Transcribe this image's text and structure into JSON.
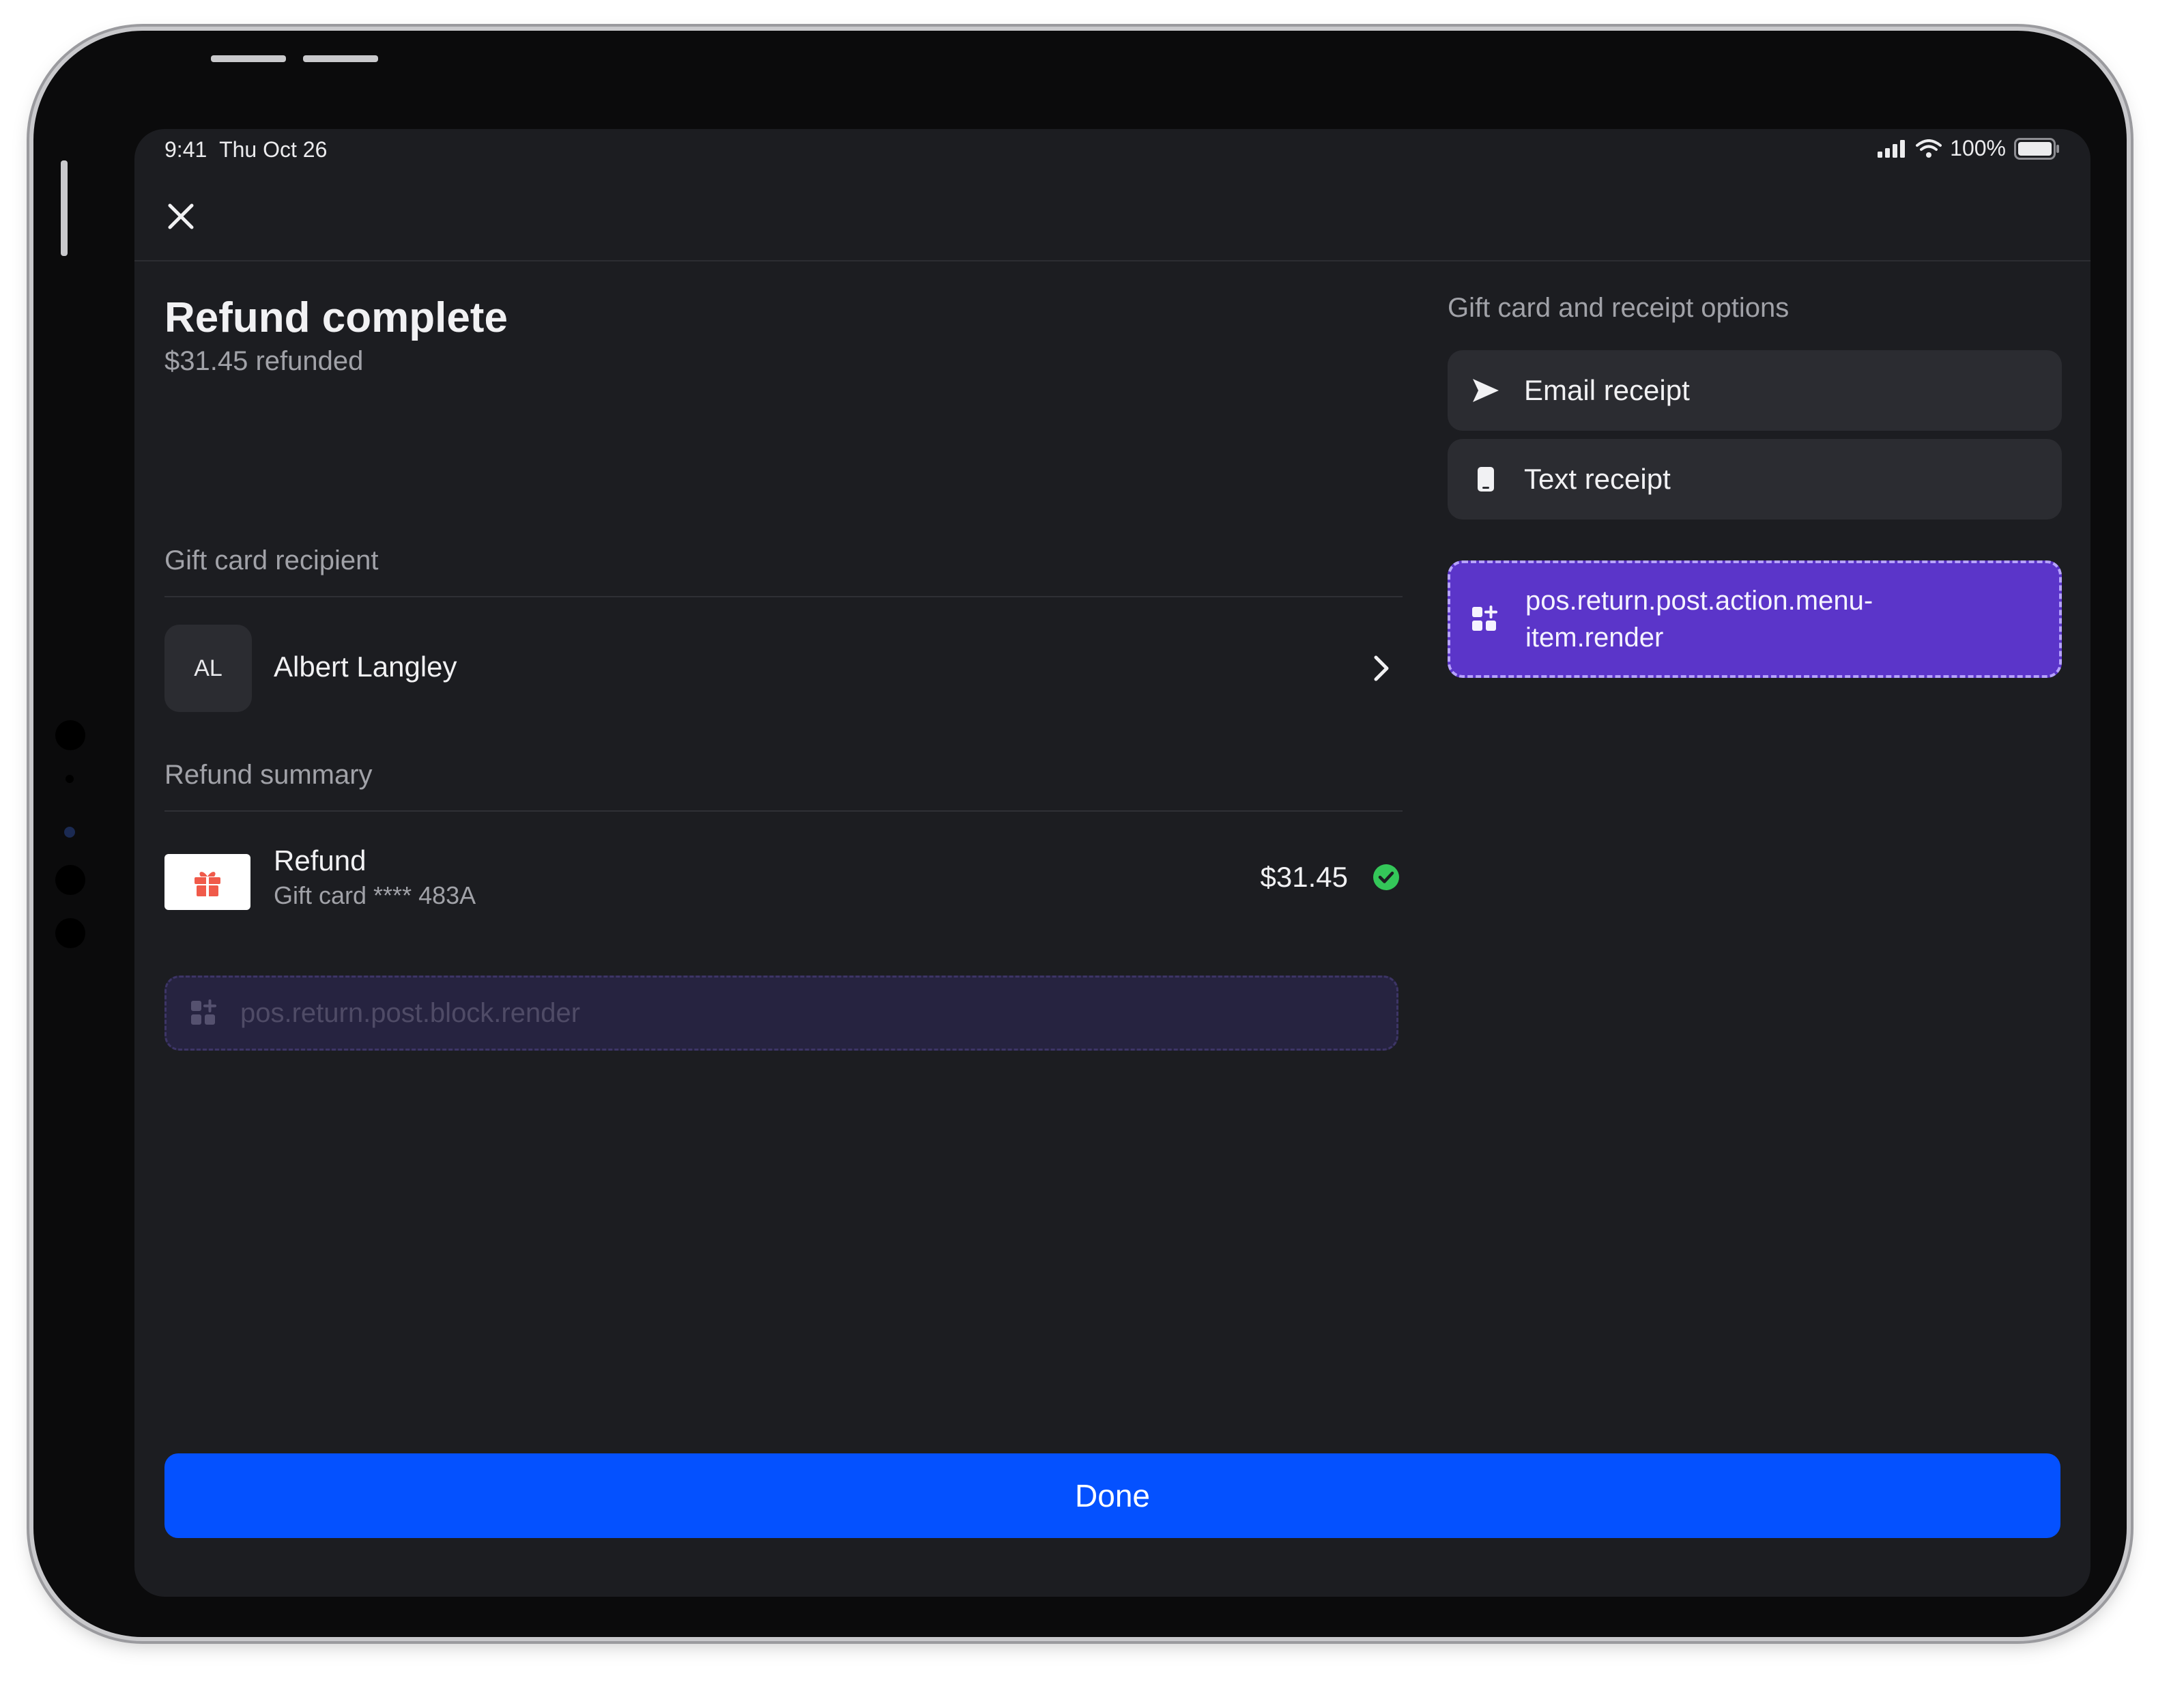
{
  "status_bar": {
    "time": "9:41",
    "date": "Thu Oct 26",
    "battery": "100%"
  },
  "header": {
    "close_icon": "close-icon"
  },
  "summary": {
    "title": "Refund complete",
    "subtitle": "$31.45 refunded"
  },
  "recipient": {
    "section_label": "Gift card recipient",
    "initials": "AL",
    "name": "Albert Langley"
  },
  "refund_summary": {
    "section_label": "Refund summary",
    "item_title": "Refund",
    "item_subtitle": "Gift card **** 483A",
    "amount": "$31.45",
    "status_icon": "check-circle-icon",
    "status_color": "#34c759"
  },
  "block_extension": {
    "label": "pos.return.post.block.render"
  },
  "options": {
    "title": "Gift card and receipt options",
    "email_label": "Email receipt",
    "text_label": "Text receipt",
    "menu_extension_label": "pos.return.post.action.menu-item.render"
  },
  "footer": {
    "done_label": "Done",
    "accent_color": "#0451ff"
  }
}
